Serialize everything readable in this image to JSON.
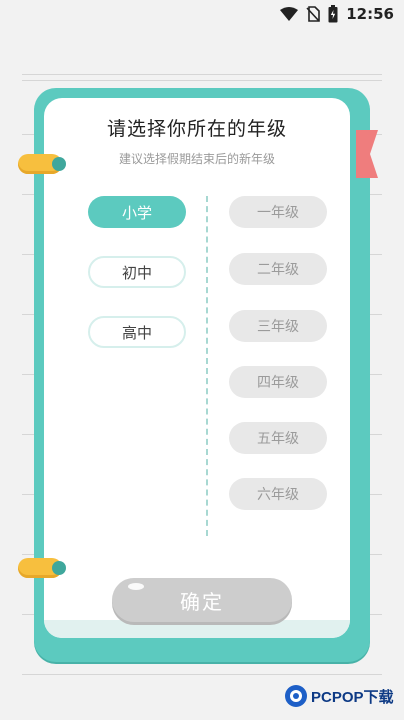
{
  "status_bar": {
    "time": "12:56",
    "icons": [
      "wifi-icon",
      "no-sim-icon",
      "battery-charging-icon"
    ]
  },
  "card": {
    "title": "请选择你所在的年级",
    "subtitle": "建议选择假期结束后的新年级"
  },
  "levels": [
    {
      "label": "小学",
      "selected": true
    },
    {
      "label": "初中",
      "selected": false
    },
    {
      "label": "高中",
      "selected": false
    }
  ],
  "grades": [
    {
      "label": "一年级"
    },
    {
      "label": "二年级"
    },
    {
      "label": "三年级"
    },
    {
      "label": "四年级"
    },
    {
      "label": "五年级"
    },
    {
      "label": "六年级"
    }
  ],
  "confirm_label": "确定",
  "watermark": {
    "text": "PCPOP下载"
  },
  "colors": {
    "accent": "#5ccabf",
    "ring": "#f7bf3e",
    "bookmark": "#ef7d7d",
    "disabled": "#cdcdcd"
  }
}
